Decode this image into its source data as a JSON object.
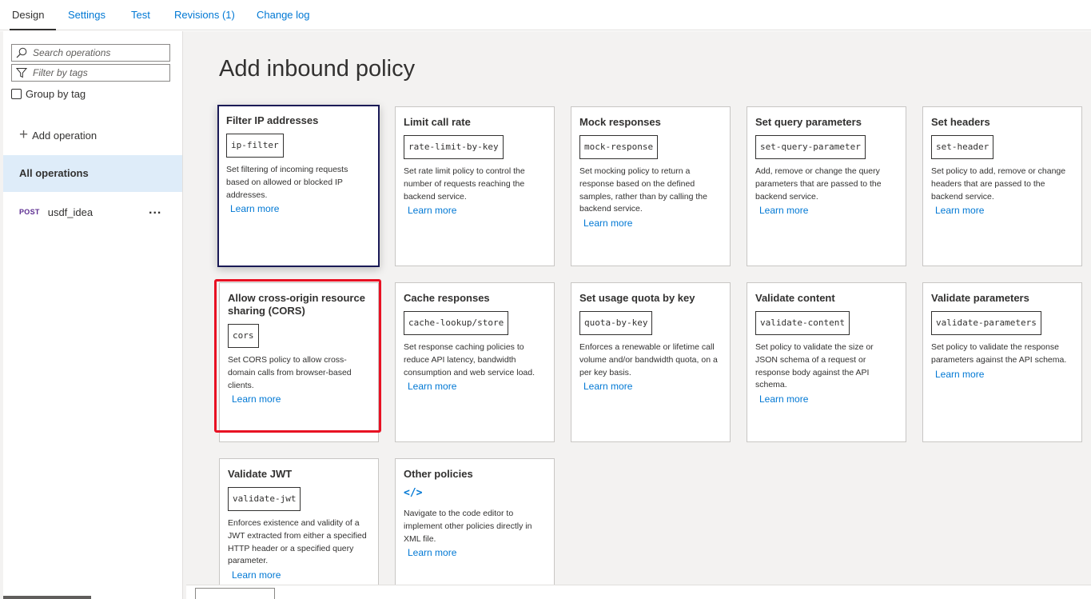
{
  "tabs": [
    {
      "label": "Design"
    },
    {
      "label": "Settings"
    },
    {
      "label": "Test"
    },
    {
      "label": "Revisions (1)"
    },
    {
      "label": "Change log"
    }
  ],
  "sidebar": {
    "search_placeholder": "Search operations",
    "filter_placeholder": "Filter by tags",
    "group_by_tag_label": "Group by tag",
    "add_operation_label": "Add operation",
    "all_operations_label": "All operations",
    "operations": [
      {
        "method": "POST",
        "name": "usdf_idea",
        "more": "..."
      }
    ]
  },
  "main": {
    "heading": "Add inbound policy",
    "cards": [
      {
        "title": "Filter IP addresses",
        "code": "ip-filter",
        "description": "Set filtering of incoming requests based on allowed or blocked IP addresses.",
        "link": "Learn more"
      },
      {
        "title": "Limit call rate",
        "code": "rate-limit-by-key",
        "description": "Set rate limit policy to control the number of requests reaching the backend service.",
        "link": "Learn more"
      },
      {
        "title": "Mock responses",
        "code": "mock-response",
        "description": "Set mocking policy to return a response based on the defined samples, rather than by calling the backend service.",
        "link": "Learn more"
      },
      {
        "title": "Set query parameters",
        "code": "set-query-parameter",
        "description": "Add, remove or change the query parameters that are passed to the backend service.",
        "link": "Learn more"
      },
      {
        "title": "Set headers",
        "code": "set-header",
        "description": "Set policy to add, remove or change headers that are passed to the backend service.",
        "link": "Learn more"
      },
      {
        "title": "Allow cross-origin resource sharing (CORS)",
        "code": "cors",
        "description": "Set CORS policy to allow cross-domain calls from browser-based clients.",
        "link": "Learn more"
      },
      {
        "title": "Cache responses",
        "code": "cache-lookup/store",
        "description": "Set response caching policies to reduce API latency, bandwidth consumption and web service load.",
        "link": "Learn more"
      },
      {
        "title": "Set usage quota by key",
        "code": "quota-by-key",
        "description": "Enforces a renewable or lifetime call volume and/or bandwidth quota, on a per key basis.",
        "link": "Learn more"
      },
      {
        "title": "Validate content",
        "code": "validate-content",
        "description": "Set policy to validate the size or JSON schema of a request or response body against the API schema.",
        "link": "Learn more"
      },
      {
        "title": "Validate parameters",
        "code": "validate-parameters",
        "description": "Set policy to validate the response parameters against the API schema.",
        "link": "Learn more"
      },
      {
        "title": "Validate JWT",
        "code": "validate-jwt",
        "description": "Enforces existence and validity of a JWT extracted from either a specified HTTP header or a specified query parameter.",
        "link": "Learn more"
      },
      {
        "title": "Other policies",
        "icon": "code-icon",
        "description": "Navigate to the code editor to implement other policies directly in XML file.",
        "link": "Learn more"
      }
    ]
  },
  "colors": {
    "accent": "#0078d4",
    "selected_border": "#1a1a56",
    "highlight": "#e81123",
    "active_item_bg": "#deecf9"
  }
}
